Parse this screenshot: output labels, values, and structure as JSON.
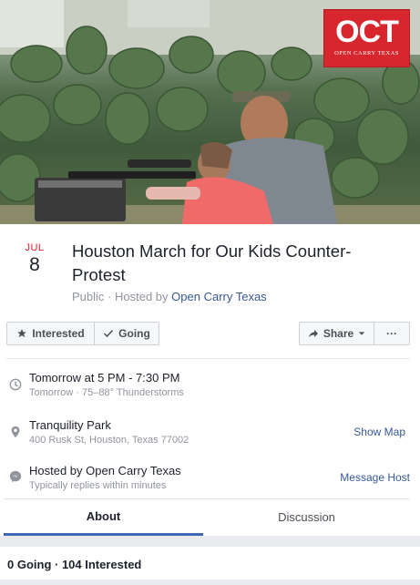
{
  "cover": {
    "logo_text": "OCT",
    "logo_subtext": "OPEN CARRY TEXAS"
  },
  "event": {
    "month": "JUL",
    "day": "8",
    "title": "Houston March for Our Kids Counter-Protest",
    "privacy": "Public",
    "hosted_by_prefix": "· Hosted by",
    "host": "Open Carry Texas"
  },
  "actions": {
    "interested_label": "Interested",
    "going_label": "Going",
    "share_label": "Share",
    "more_label": "···"
  },
  "details": {
    "time_main": "Tomorrow at 5 PM - 7:30 PM",
    "time_sub": "Tomorrow · 75–88° Thunderstorms",
    "place_main": "Tranquility Park",
    "place_sub": "400 Rusk St, Houston, Texas 77002",
    "show_map": "Show Map",
    "host_main": "Hosted by Open Carry Texas",
    "host_sub": "Typically replies within minutes",
    "message_host": "Message Host"
  },
  "tabs": [
    {
      "label": "About"
    },
    {
      "label": "Discussion"
    }
  ],
  "stats": {
    "going_interested": "0 Going · 104 Interested"
  },
  "colors": {
    "accent": "#4267b2",
    "link": "#365899",
    "date_red": "#e41e2b",
    "logo_red": "#d8262e"
  }
}
